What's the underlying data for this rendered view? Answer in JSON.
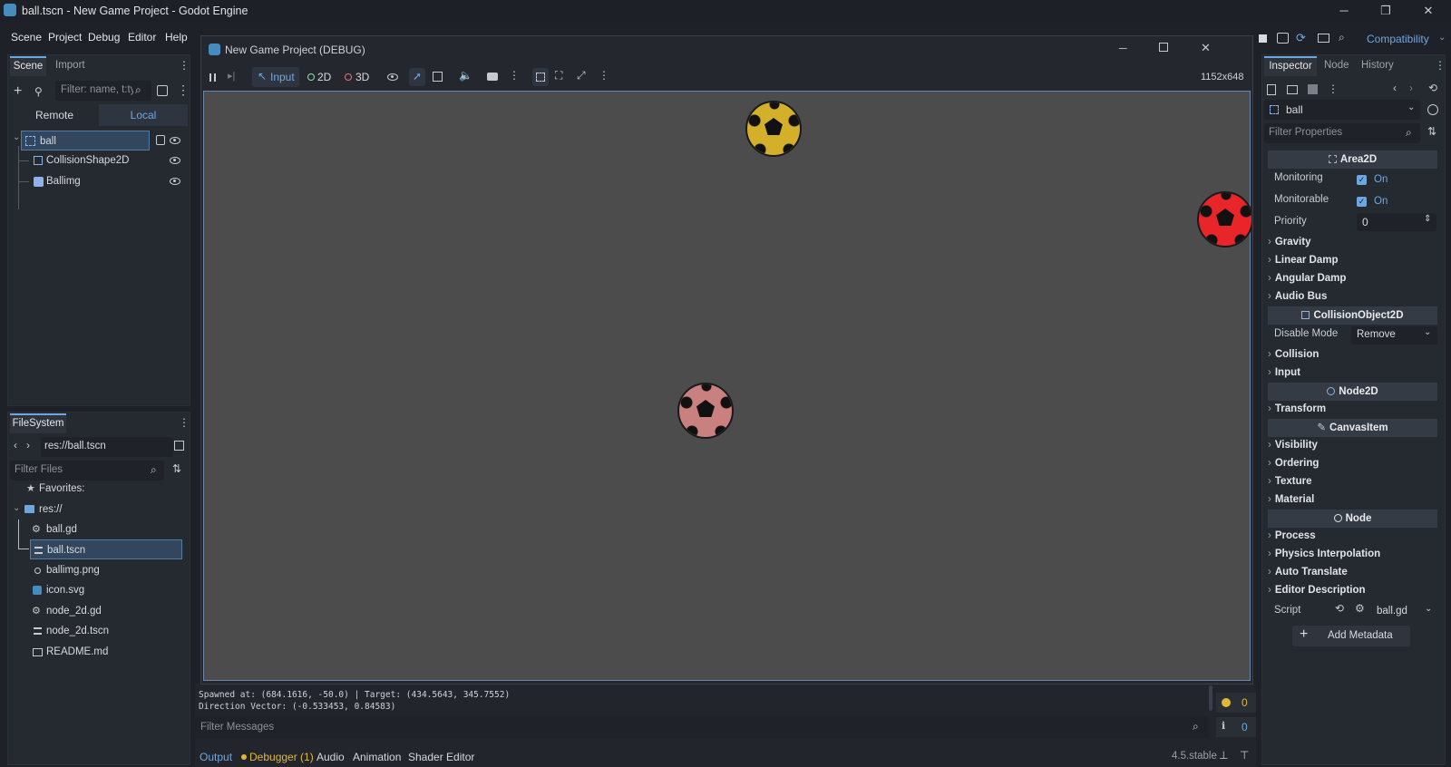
{
  "window": {
    "title": "ball.tscn - New Game Project - Godot Engine"
  },
  "menu": [
    "Scene",
    "Project",
    "Debug",
    "Editor",
    "Help"
  ],
  "renderer": "Compatibility",
  "scene_dock": {
    "tabs": [
      "Scene",
      "Import"
    ],
    "filter_placeholder": "Filter: name, t:ty",
    "remote_label": "Remote",
    "local_label": "Local",
    "nodes": [
      {
        "name": "ball"
      },
      {
        "name": "CollisionShape2D"
      },
      {
        "name": "Ballimg"
      }
    ]
  },
  "filesystem": {
    "title": "FileSystem",
    "path": "res://ball.tscn",
    "filter_placeholder": "Filter Files",
    "favorites": "Favorites:",
    "root": "res://",
    "files": [
      "ball.gd",
      "ball.tscn",
      "ballimg.png",
      "icon.svg",
      "node_2d.gd",
      "node_2d.tscn",
      "README.md"
    ]
  },
  "game_window": {
    "title": "New Game Project (DEBUG)",
    "input_label": "Input",
    "mode_2d": "2D",
    "mode_3d": "3D",
    "resolution": "1152x648",
    "balls": [
      {
        "color": "#d4af2a"
      },
      {
        "color": "#e8262a"
      },
      {
        "color": "#c9817f"
      }
    ]
  },
  "output": {
    "lines": [
      "Spawned at: (684.1616, -50.0) | Target: (434.5643, 345.7552)",
      "Direction Vector: (-0.533453, 0.84583)"
    ],
    "filter_placeholder": "Filter Messages",
    "warnings": "0",
    "errors": "0"
  },
  "bottom_tabs": [
    "Output",
    "Debugger (1)",
    "Audio",
    "Animation",
    "Shader Editor"
  ],
  "version": "4.5.stable",
  "inspector": {
    "tabs": [
      "Inspector",
      "Node",
      "History"
    ],
    "object": "ball",
    "filter_placeholder": "Filter Properties",
    "area2d": "Area2D",
    "monitoring_label": "Monitoring",
    "monitoring_value": "On",
    "monitorable_label": "Monitorable",
    "monitorable_value": "On",
    "priority_label": "Priority",
    "priority_value": "0",
    "area_sections": [
      "Gravity",
      "Linear Damp",
      "Angular Damp",
      "Audio Bus"
    ],
    "collision_object": "CollisionObject2D",
    "disable_mode_label": "Disable Mode",
    "disable_mode_value": "Remove",
    "co_sections": [
      "Collision",
      "Input"
    ],
    "node2d": "Node2D",
    "n2d_sections": [
      "Transform"
    ],
    "canvas_item": "CanvasItem",
    "ci_sections": [
      "Visibility",
      "Ordering",
      "Texture",
      "Material"
    ],
    "node": "Node",
    "node_sections": [
      "Process",
      "Physics Interpolation",
      "Auto Translate",
      "Editor Description"
    ],
    "script_label": "Script",
    "script_value": "ball.gd",
    "add_metadata": "Add Metadata"
  }
}
